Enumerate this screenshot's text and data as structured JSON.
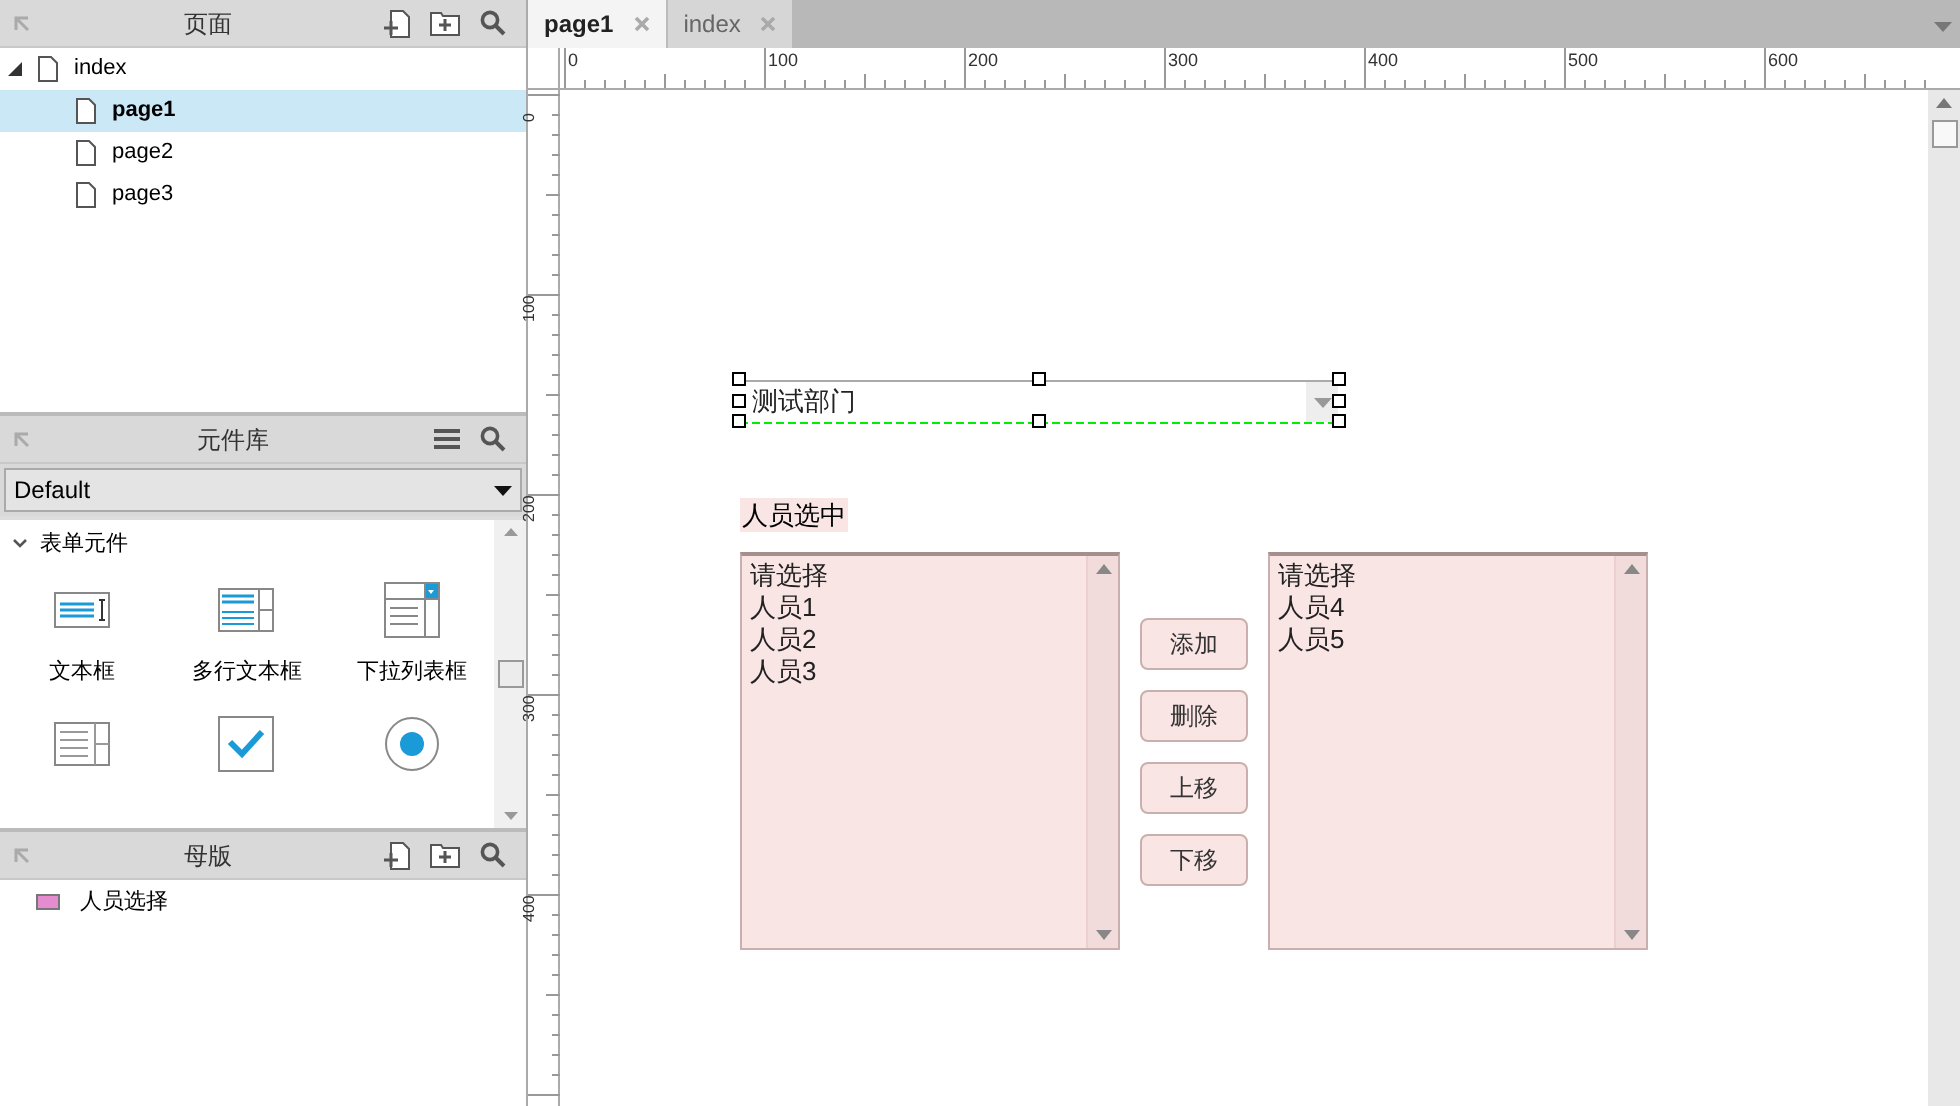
{
  "pages_panel": {
    "title": "页面",
    "tree": [
      {
        "label": "index",
        "expanded": true,
        "selected": false,
        "children": [
          {
            "label": "page1",
            "selected": true
          },
          {
            "label": "page2",
            "selected": false
          },
          {
            "label": "page3",
            "selected": false
          }
        ]
      }
    ]
  },
  "widgets_panel": {
    "title": "元件库",
    "library": "Default",
    "group": {
      "label": "表单元件",
      "expanded": true,
      "items": [
        {
          "kind": "textbox",
          "label": "文本框"
        },
        {
          "kind": "textarea",
          "label": "多行文本框"
        },
        {
          "kind": "dropdown",
          "label": "下拉列表框"
        },
        {
          "kind": "listbox"
        },
        {
          "kind": "checkbox"
        },
        {
          "kind": "radio"
        }
      ]
    }
  },
  "masters_panel": {
    "title": "母版",
    "items": [
      {
        "label": "人员选择"
      }
    ]
  },
  "tabs": [
    {
      "label": "page1",
      "selected": true
    },
    {
      "label": "index",
      "selected": false
    }
  ],
  "ruler": {
    "x_labels": [
      "0",
      "100",
      "200",
      "300",
      "400",
      "500",
      "600"
    ],
    "y_labels": [
      "0",
      "100",
      "200",
      "300",
      "400"
    ]
  },
  "canvas": {
    "dropdown": {
      "value": "测试部门",
      "selected": true
    },
    "label": "人员选中",
    "left_list": {
      "options": [
        "请选择",
        "人员1",
        "人员2",
        "人员3"
      ]
    },
    "buttons": [
      "添加",
      "删除",
      "上移",
      "下移"
    ],
    "right_list": {
      "options": [
        "请选择",
        "人员4",
        "人员5"
      ]
    }
  }
}
